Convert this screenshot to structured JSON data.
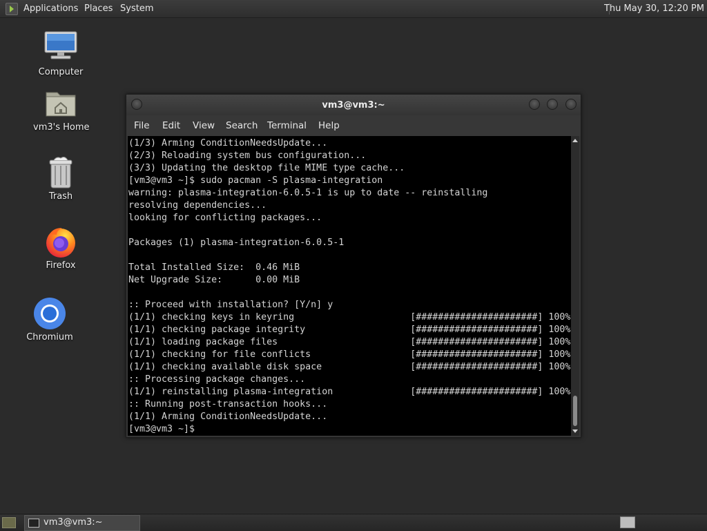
{
  "top_panel": {
    "menus": [
      "Applications",
      "Places",
      "System"
    ],
    "clock": "Thu May 30, 12:20 PM"
  },
  "desktop_icons": [
    {
      "label": "Computer",
      "icon": "computer-icon"
    },
    {
      "label": "vm3's Home",
      "icon": "home-folder-icon"
    },
    {
      "label": "Trash",
      "icon": "trash-icon"
    },
    {
      "label": "Firefox",
      "icon": "firefox-icon"
    },
    {
      "label": "Chromium",
      "icon": "chromium-icon"
    }
  ],
  "terminal_window": {
    "title": "vm3@vm3:~",
    "menu": [
      "File",
      "Edit",
      "View",
      "Search",
      "Terminal",
      "Help"
    ],
    "output": "(1/3) Arming ConditionNeedsUpdate...\n(2/3) Reloading system bus configuration...\n(3/3) Updating the desktop file MIME type cache...\n[vm3@vm3 ~]$ sudo pacman -S plasma-integration\nwarning: plasma-integration-6.0.5-1 is up to date -- reinstalling\nresolving dependencies...\nlooking for conflicting packages...\n\nPackages (1) plasma-integration-6.0.5-1\n\nTotal Installed Size:  0.46 MiB\nNet Upgrade Size:      0.00 MiB\n\n:: Proceed with installation? [Y/n] y\n(1/1) checking keys in keyring                     [######################] 100%\n(1/1) checking package integrity                   [######################] 100%\n(1/1) loading package files                        [######################] 100%\n(1/1) checking for file conflicts                  [######################] 100%\n(1/1) checking available disk space                [######################] 100%\n:: Processing package changes...\n(1/1) reinstalling plasma-integration              [######################] 100%\n:: Running post-transaction hooks...\n(1/1) Arming ConditionNeedsUpdate...\n[vm3@vm3 ~]$ "
  },
  "taskbar": {
    "tasks": [
      {
        "label": "vm3@vm3:~"
      }
    ]
  },
  "colors": {
    "desktop_bg": "#2b2b2b",
    "terminal_bg": "#000000",
    "terminal_fg": "#d4d4d4"
  }
}
